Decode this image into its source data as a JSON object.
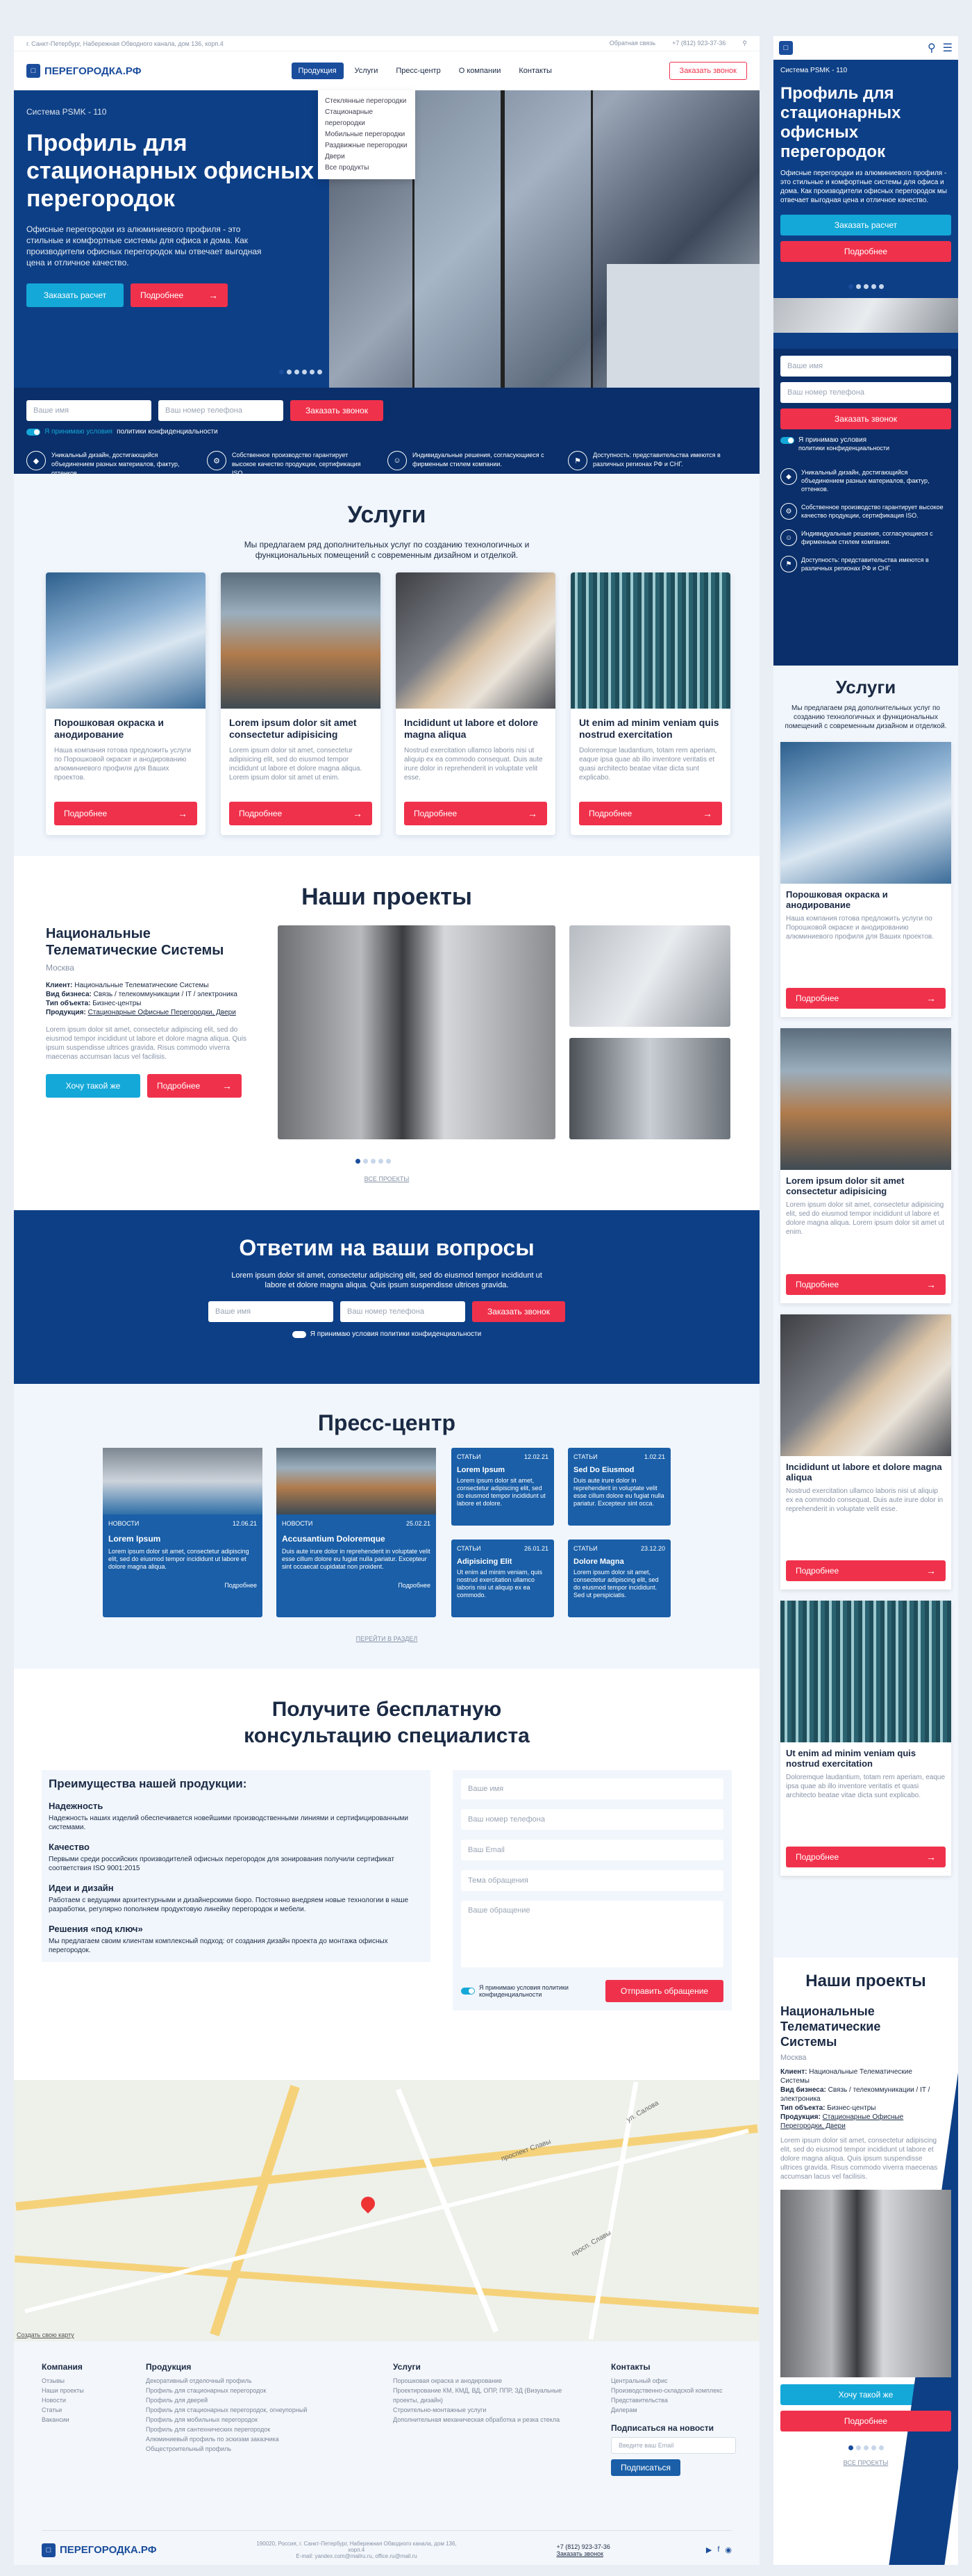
{
  "topbar": {
    "address": "г. Санкт-Петербург, Набережная Обводного канала, дом 136, корп.4",
    "callback": "Обратная связь",
    "phone": "+7 (812) 923-37-36"
  },
  "brand": {
    "name": "ПЕРЕГОРОДКА.РФ"
  },
  "nav": {
    "items": [
      "Продукция",
      "Услуги",
      "Пресс-центр",
      "О компании",
      "Контакты"
    ],
    "call_button": "Заказать звонок"
  },
  "dropdown": {
    "items": [
      "Стеклянные перегородки",
      "Стационарные перегородки",
      "Мобильные перегородки",
      "Раздвижные перегородки",
      "Двери",
      "Все продукты"
    ]
  },
  "hero": {
    "kicker": "Система PSMK - 110",
    "title": "Профиль для стационарных офисных перегородок",
    "text": "Офисные перегородки из алюминиевого профиля - это стильные и комфортные системы для офиса и дома. Как производители офисных перегородок мы отвечает выгодная цена и отличное качество.",
    "btn_calc": "Заказать расчет",
    "btn_more": "Подробнее"
  },
  "callform": {
    "name_ph": "Ваше имя",
    "phone_ph": "Ваш номер телефона",
    "submit": "Заказать звонок",
    "consent_a": "Я принимаю условия",
    "consent_b": "политики конфиденциальности"
  },
  "features": [
    "Уникальный дизайн, достигающийся объединением разных материалов, фактур, оттенков.",
    "Собственное производство гарантирует высокое качество продукции, сертификация ISO.",
    "Индивидуальные решения, согласующиеся с фирменным стилем компании.",
    "Доступность: представительства имеются в различных регионах РФ и СНГ."
  ],
  "services": {
    "title": "Услуги",
    "intro": "Мы предлагаем ряд дополнительных услуг по созданию технологичных и функциональных помещений с современным дизайном и отделкой.",
    "cards": [
      {
        "title": "Порошковая окраска и анодирование",
        "text": "Наша компания готова предложить услуги по Порошковой окраске и анодированию алюминиевого профиля для Ваших проектов.",
        "btn": "Подробнее"
      },
      {
        "title": "Lorem ipsum dolor sit amet consectetur adipisicing",
        "text": "Lorem ipsum dolor sit amet, consectetur adipisicing elit, sed do eiusmod tempor incididunt ut labore et dolore magna aliqua. Lorem ipsum dolor sit amet ut enim.",
        "btn": "Подробнее"
      },
      {
        "title": "Incididunt ut labore et dolore magna aliqua",
        "text": "Nostrud exercitation ullamco laboris nisi ut aliquip ex ea commodo consequat. Duis aute irure dolor in reprehenderit in voluptate velit esse.",
        "btn": "Подробнее"
      },
      {
        "title": "Ut enim ad minim veniam quis nostrud exercitation",
        "text": "Doloremque laudantium, totam rem aperiam, eaque ipsa quae ab illo inventore veritatis et quasi architecto beatae vitae dicta sunt explicabo.",
        "btn": "Подробнее"
      }
    ]
  },
  "projects": {
    "title": "Наши проекты",
    "name": "Национальные Телематические Системы",
    "city": "Москва",
    "client": "Национальные Телематические Системы",
    "business": "Связь / телекоммуникации / IT / электроника",
    "office": "Бизнес-центры",
    "product": "Стационарные Офисные Перегородки, Двери",
    "l_client": "Клиент:",
    "l_business": "Вид бизнеса:",
    "l_office": "Тип объекта:",
    "l_product": "Продукция:",
    "text": "Lorem ipsum dolor sit amet, consectetur adipiscing elit, sed do eiusmod tempor incididunt ut labore et dolore magna aliqua. Quis ipsum suspendisse ultrices gravida. Risus commodo viverra maecenas accumsan lacus vel facilisis.",
    "btn_same": "Хочу такой же",
    "btn_more": "Подробнее",
    "all": "ВСЕ ПРОЕКТЫ"
  },
  "questions": {
    "title": "Ответим на ваши вопросы",
    "text": "Lorem ipsum dolor sit amet, consectetur adipiscing elit, sed do eiusmod tempor incididunt ut labore et dolore magna aliqua. Quis ipsum suspendisse ultrices gravida.",
    "name_ph": "Ваше имя",
    "phone_ph": "Ваш номер телефона",
    "submit": "Заказать звонок",
    "consent": "Я принимаю условия политики конфиденциальности"
  },
  "press": {
    "title": "Пресс-центр",
    "all": "ПЕРЕЙТИ В РАЗДЕЛ",
    "big": [
      {
        "tag": "НОВОСТИ",
        "date": "12.06.21",
        "title": "Lorem Ipsum",
        "text": "Lorem ipsum dolor sit amet, consectetur adipiscing elit, sed do eiusmod tempor incididunt ut labore et dolore magna aliqua.",
        "more": "Подробнее"
      },
      {
        "tag": "НОВОСТИ",
        "date": "25.02.21",
        "title": "Accusantium Doloremque",
        "text": "Duis aute irure dolor in reprehenderit in voluptate velit esse cillum dolore eu fugiat nulla pariatur. Excepteur sint occaecat cupidatat non proident.",
        "more": "Подробнее"
      }
    ],
    "small": [
      {
        "tag": "СТАТЬИ",
        "date": "12.02.21",
        "title": "Lorem Ipsum",
        "text": "Lorem ipsum dolor sit amet, consectetur adipiscing elit, sed do eiusmod tempor incididunt ut labore et dolore."
      },
      {
        "tag": "СТАТЬИ",
        "date": "1.02.21",
        "title": "Sed Do Eiusmod",
        "text": "Duis aute irure dolor in reprehenderit in voluptate velit esse cillum dolore eu fugiat nulla pariatur. Excepteur sint occa."
      },
      {
        "tag": "СТАТЬИ",
        "date": "26.01.21",
        "title": "Adipisicing Elit",
        "text": "Ut enim ad minim veniam, quis nostrud exercitation ullamco laboris nisi ut aliquip ex ea commodo."
      },
      {
        "tag": "СТАТЬИ",
        "date": "23.12.20",
        "title": "Dolore Magna",
        "text": "Lorem ipsum dolor sit amet, consectetur adipiscing elit, sed do eiusmod tempor incididunt. Sed ut perspiciatis."
      }
    ]
  },
  "consult": {
    "title": "Получите бесплатную консультацию специалиста",
    "adv_title": "Преимущества  нашей продукции:",
    "advantages": [
      {
        "h": "Надежность",
        "t": "Надежность наших изделий обеспечивается новейшими производственными линиями и сертифицированными системами."
      },
      {
        "h": "Качество",
        "t": "Первыми среди российских производителей офисных перегородок для зонирования получили сертификат соответствия ISO 9001:2015"
      },
      {
        "h": "Идеи и дизайн",
        "t": "Работаем с ведущими архитектурными и дизайнерскими бюро. Постоянно внедряем новые технологии в наше разработки, регулярно пополняем продуктовую линейку перегородок и мебели."
      },
      {
        "h": "Решения «под ключ»",
        "t": "Мы предлагаем своим клиентам комплексный подход: от создания дизайн проекта до монтажа офисных перегородок."
      }
    ],
    "f_name": "Ваше имя",
    "f_phone": "Ваш номер телефона",
    "f_email": "Ваш Email",
    "f_topic": "Тема обращения",
    "f_msg": "Ваше обращение",
    "consent": "Я принимаю условия политики конфиденциальности",
    "submit": "Отправить обращение"
  },
  "map": {
    "label1": "проспект Славы",
    "label2": "ул. Салова",
    "label3": "просп. Славы",
    "credit": "Создать свою карту"
  },
  "footer": {
    "c1": {
      "h": "Компания",
      "items": [
        "Отзывы",
        "Наши проекты",
        "Новости",
        "Статьи",
        "Вакансии"
      ]
    },
    "c2": {
      "h": "Продукция",
      "items": [
        "Декоративный отделочный профиль",
        "Профиль для стационарных перегородок",
        "Профиль для дверей",
        "Профиль для стационарных перегородок, огнеупорный",
        "Профиль для мобильных перегородок",
        "Профиль для сантехнических перегородок",
        "Алюминиевый профиль по эскизам заказчика",
        "Общестроительный профиль"
      ]
    },
    "c3": {
      "h": "Услуги",
      "items": [
        "Порошковая окраска и анодирование",
        "Проектирование КМ, КМД, ВД, ОПР, ППР, ЗД (Визуальные проекты, дизайн)",
        "Строительно-монтажные услуги",
        "Дополнительная механическая обработка и резка стекла"
      ]
    },
    "c4": {
      "h": "Контакты",
      "items": [
        "Центральный офис",
        "Производственно-складской комплекс",
        "Представительства",
        "Дилерам"
      ]
    },
    "sub_h": "Подписаться на новости",
    "sub_ph": "Введите ваш Email",
    "sub_btn": "Подписаться",
    "address": "190020, Россия, г. Санкт-Петербург, Набережная Обводного канала, дом 136, корп.4",
    "email": "E-mail: yandex.com@mailru.ru, office.ru@mail.ru",
    "phone": "+7 (812) 923-37-36",
    "order_call": "Заказать звонок"
  }
}
